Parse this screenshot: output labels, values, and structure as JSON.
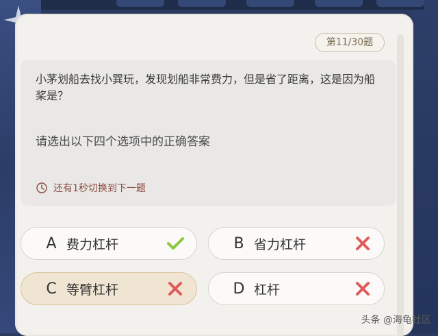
{
  "counter": "第11/30题",
  "question": "小茅划船去找小巽玩，发现划船非常费力，但是省了距离，这是因为船桨是？",
  "instruction": "请选出以下四个选项中的正确答案",
  "timer_text": "还有1秒切换到下一题",
  "options": [
    {
      "letter": "A",
      "text": "费力杠杆",
      "mark": "check-icon"
    },
    {
      "letter": "B",
      "text": "省力杠杆",
      "mark": "cross-icon"
    },
    {
      "letter": "C",
      "text": "等臂杠杆",
      "mark": "cross-icon"
    },
    {
      "letter": "D",
      "text": "杠杆",
      "mark": "cross-icon"
    }
  ],
  "watermark": "头条 @海龟社区",
  "colors": {
    "check": "#8cc63f",
    "cross": "#e05a5a",
    "selected_bg": "#f0e5d2"
  }
}
